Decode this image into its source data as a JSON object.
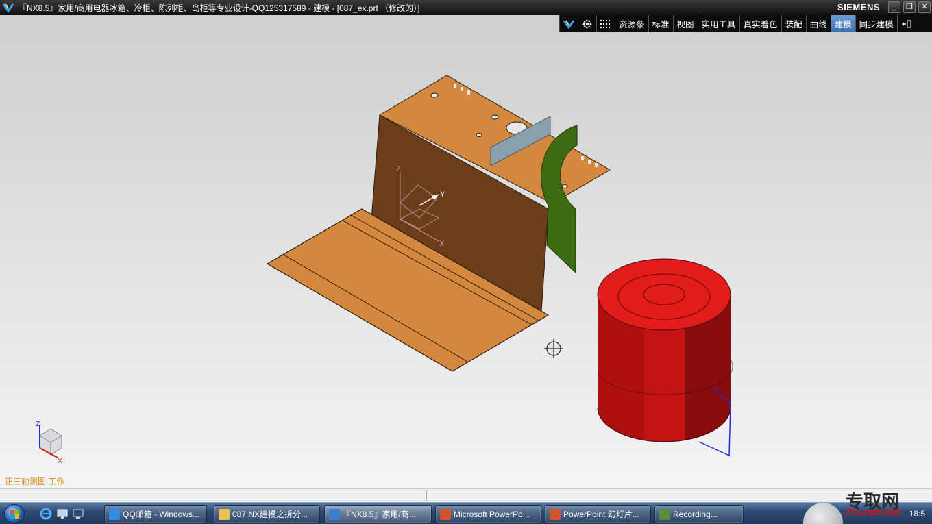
{
  "window": {
    "title": "『NX8.5』家用/商用电器冰箱、冷柜、陈列柜、岛柜等专业设计-QQ125317589 - 建模 - [087_ex.prt （修改的）]",
    "brand": "SIEMENS",
    "controls": {
      "minimize": "_",
      "restore": "❐",
      "close": "✕"
    }
  },
  "ribbon": {
    "tabs": [
      {
        "label": "资源条",
        "active": false
      },
      {
        "label": "标准",
        "active": false
      },
      {
        "label": "视图",
        "active": false
      },
      {
        "label": "实用工具",
        "active": false
      },
      {
        "label": "真实着色",
        "active": false
      },
      {
        "label": "装配",
        "active": false
      },
      {
        "label": "曲线",
        "active": false
      },
      {
        "label": "建模",
        "active": true
      },
      {
        "label": "同步建模",
        "active": false
      }
    ],
    "icons": [
      "nx-logo-icon",
      "gear-icon",
      "grid-icon",
      "ribbon-options-icon"
    ]
  },
  "viewport": {
    "view_label": "正三轴测图 工作",
    "csys_labels": {
      "x": "X",
      "y": "Y",
      "z": "Z"
    },
    "triad_labels": {
      "x": "X",
      "z": "Z"
    },
    "colors": {
      "sheet_top": "#d4883e",
      "sheet_side": "#6b3d18",
      "flap_green": "#3d6b12",
      "datum_plane": "#8aa0ad",
      "cylinder_red": "#e21b1b",
      "cylinder_dark": "#8c0f0f",
      "sketch_blue": "#1c2fd6"
    }
  },
  "taskbar": {
    "tasks": [
      {
        "label": "QQ邮箱 - Windows...",
        "icon": "ie-icon",
        "active": false
      },
      {
        "label": "087.NX建模之拆分...",
        "icon": "folder-icon",
        "active": false
      },
      {
        "label": "『NX8.5』家用/商...",
        "icon": "nx-icon",
        "active": true
      },
      {
        "label": "Microsoft PowerPo...",
        "icon": "powerpoint-icon",
        "active": false
      },
      {
        "label": "PowerPoint 幻灯片...",
        "icon": "powerpoint-icon",
        "active": false
      },
      {
        "label": "Recording...",
        "icon": "recording-icon",
        "active": false
      }
    ],
    "watermark": {
      "text": "专取网",
      "url": "Zhuanzhi.Net"
    },
    "clock": "18:5"
  }
}
